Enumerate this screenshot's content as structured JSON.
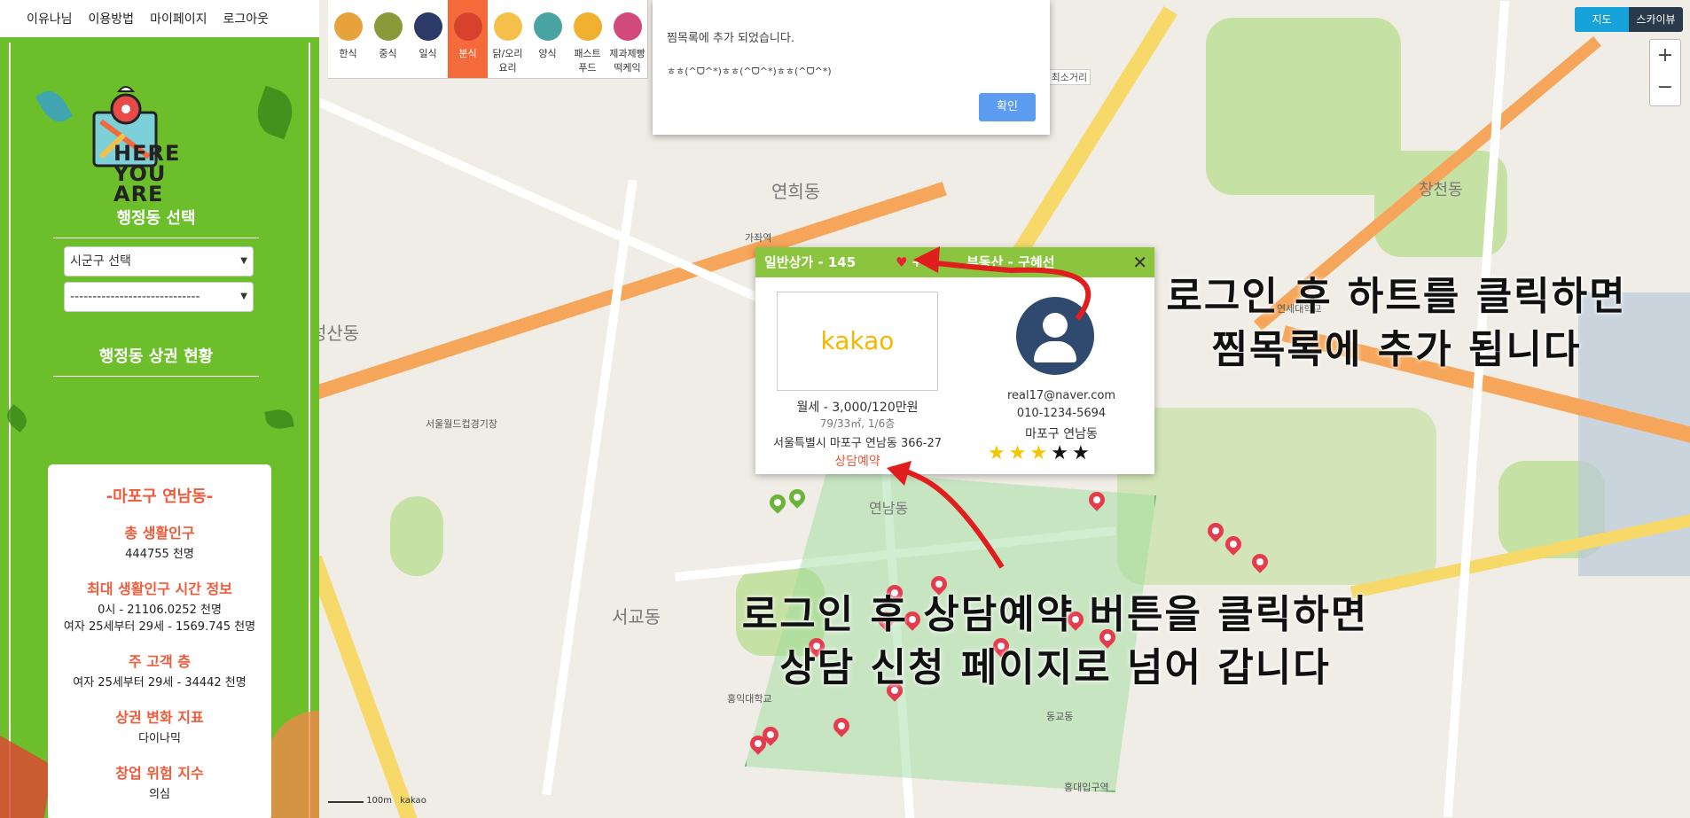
{
  "topnav": {
    "items": [
      "이유나님",
      "이용방법",
      "마이페이지",
      "로그아웃"
    ]
  },
  "sidebar": {
    "logo_text": "HERE\nYOU\nARE",
    "dong_title": "행정동 선택",
    "select_sigungu": "시군구 선택",
    "select_dong": "-----------------------------",
    "status_title": "행정동 상권 현황",
    "area_name": "-마포구 연남동-",
    "stats": [
      {
        "label": "총 생활인구",
        "value": "444755 천명"
      },
      {
        "label": "최대 생활인구 시간 정보",
        "value": "0시 - 21106.0252 천명\n여자 25세부터 29세 - 1569.745 천명"
      },
      {
        "label": "주 고객 층",
        "value": "여자 25세부터 29세 - 34442 천명"
      },
      {
        "label": "상권 변화 지표",
        "value": "다이나믹"
      },
      {
        "label": "창업 위험 지수",
        "value": "의심"
      }
    ]
  },
  "categories": [
    {
      "label": "한식",
      "color": "#e8a23c"
    },
    {
      "label": "중식",
      "color": "#8a9a3a"
    },
    {
      "label": "일식",
      "color": "#2b3a66"
    },
    {
      "label": "분식",
      "color": "#d8422c",
      "active": true
    },
    {
      "label": "닭/오리\n요리",
      "color": "#f5c04a"
    },
    {
      "label": "양식",
      "color": "#4aa3a3"
    },
    {
      "label": "패스트\n푸드",
      "color": "#f0b030"
    },
    {
      "label": "제과제빵\n떡케익",
      "color": "#d24a7a"
    }
  ],
  "dialog": {
    "message": "찜목록에 추가 되었습니다.",
    "emoticon": "ㅎㅎ(^ᗜ^*)ㅎㅎ(^ᗜ^*)ㅎㅎ(^ᗜ^*)",
    "ok_label": "확인"
  },
  "map": {
    "type_map": "지도",
    "type_sky": "스카이뷰",
    "zoom_in": "+",
    "zoom_out": "−",
    "scale": "100m",
    "provider": "kakao",
    "min_distance_label": "의 최소거리"
  },
  "popup": {
    "header_left": "일반상가 - 145",
    "heart": "♥",
    "like_count": "+0",
    "header_right": "부동산 - 구혜선",
    "close": "✕",
    "image_text": "kakao",
    "price": "월세 - 3,000/120만원",
    "area_floor": "79/33㎡, 1/6층",
    "address": "서울특별시 마포구 연남동 366-27",
    "consult_button": "상담예약",
    "email": "real17@naver.com",
    "phone": "010-1234-5694",
    "region": "마포구 연남동",
    "rating": 3,
    "rating_max": 5
  },
  "annotations": {
    "top": "로그인 후 하트를 클릭하면\n찜목록에 추가 됩니다",
    "bottom": "로그인 후 상담예약 버튼을 클릭하면\n상담 신청 페이지로 넘어 갑니다"
  },
  "map_labels": [
    "연희동",
    "성산동",
    "연남동",
    "서교동",
    "동교동",
    "창천동",
    "서울월드컵경기장",
    "홍익대학교",
    "연세대학교",
    "가좌역",
    "홍대입구역"
  ],
  "colors": {
    "accent": "#6cbf2b",
    "brand_orange": "#ef5a3a",
    "header_green": "#8bc53f"
  }
}
